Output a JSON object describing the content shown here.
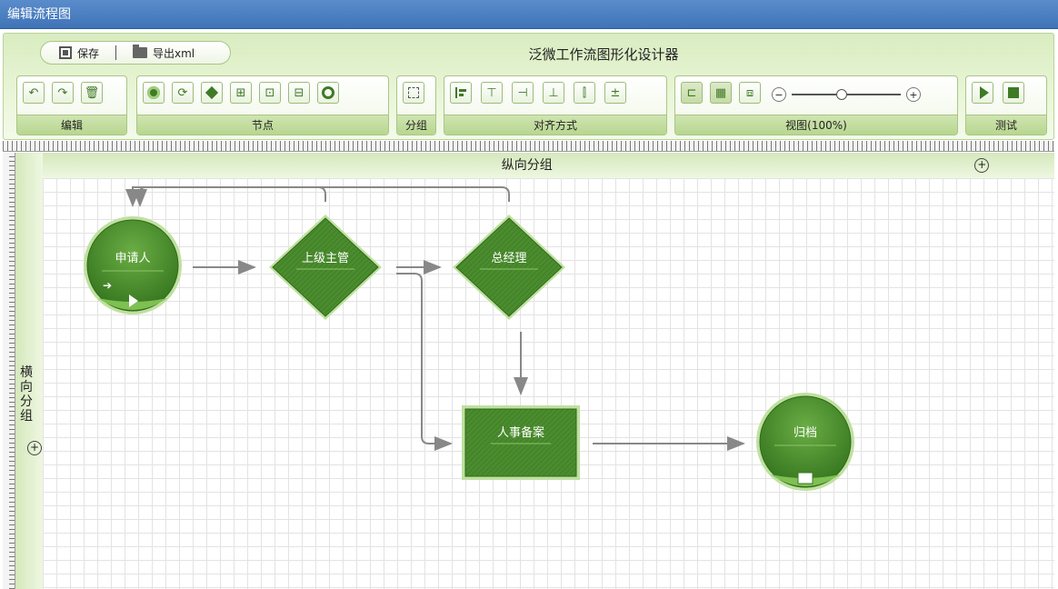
{
  "window": {
    "title": "编辑流程图"
  },
  "app": {
    "title": "泛微工作流图形化设计器"
  },
  "file_bar": {
    "save_label": "保存",
    "export_label": "导出xml"
  },
  "toolbar_groups": {
    "edit": {
      "label": "编辑",
      "icons": [
        "undo-icon",
        "redo-icon",
        "delete-icon"
      ]
    },
    "node": {
      "label": "节点",
      "icons": [
        "start-node-icon",
        "loop-node-icon",
        "decision-node-icon",
        "branch-node-icon",
        "merge-node-icon",
        "subprocess-node-icon",
        "end-node-icon"
      ]
    },
    "group": {
      "label": "分组",
      "icons": [
        "group-icon"
      ]
    },
    "align": {
      "label": "对齐方式",
      "icons": [
        "align-left-icon",
        "align-top-icon",
        "align-right-icon",
        "align-bottom-icon",
        "align-center-h-icon",
        "align-center-v-icon"
      ]
    },
    "view": {
      "label": "视图(100%)",
      "zoom_level": 0.45,
      "icons": [
        "grid-toggle-icon",
        "ruler-toggle-icon",
        "fit-view-icon"
      ]
    },
    "test": {
      "label": "测试",
      "icons": [
        "run-test-icon",
        "stop-test-icon"
      ]
    }
  },
  "swimlanes": {
    "vertical_label": "纵向分组",
    "horizontal_label": "横向分组"
  },
  "nodes": {
    "applicant": "申请人",
    "supervisor": "上级主管",
    "general_manager": "总经理",
    "hr_record": "人事备案",
    "archive": "归档"
  },
  "colors": {
    "node_green": "#4a8c2e",
    "node_border": "#77b94b",
    "title_blue": "#4a7fc0",
    "accent_green": "#cfe4b0"
  }
}
